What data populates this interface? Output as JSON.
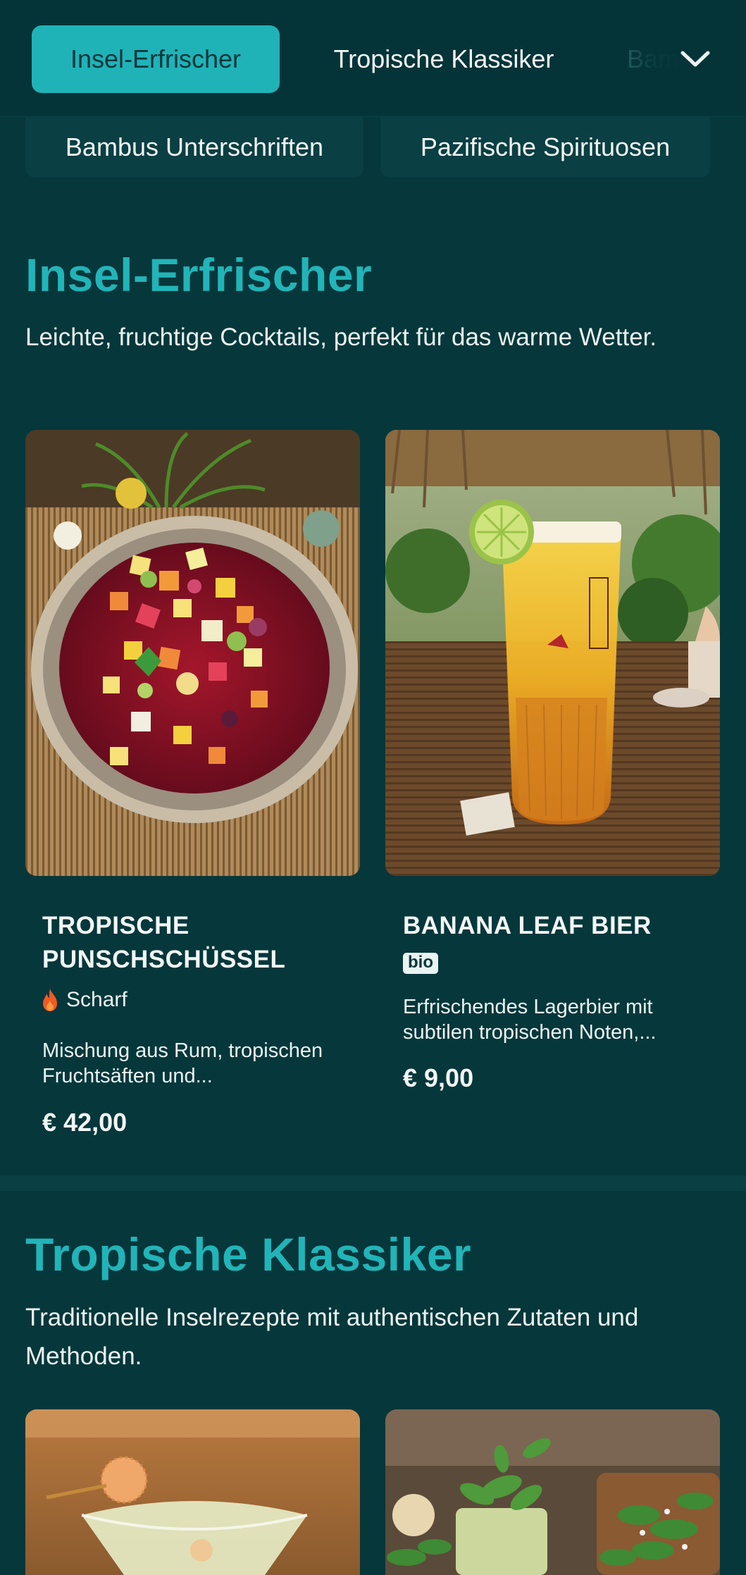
{
  "nav": {
    "tabs": [
      {
        "label": "Insel-Erfrischer",
        "active": true
      },
      {
        "label": "Tropische Klassiker",
        "active": false
      },
      {
        "label": "Bambus Unterschriften",
        "active": false
      }
    ],
    "more_icon": "chevron-down-icon",
    "pills": [
      {
        "label": "Bambus Unterschriften"
      },
      {
        "label": "Pazifische Spirituosen"
      }
    ]
  },
  "sections": [
    {
      "title": "Insel-Erfrischer",
      "description": "Leichte, fruchtige Cocktails, perfekt für das warme Wetter.",
      "items": [
        {
          "name": "TROPISCHE PUNSCHSCHÜSSEL",
          "tag": "Scharf",
          "tag_icon": "flame-icon",
          "description": "Mischung aus Rum, tropischen Fruchtsäften und...",
          "price": "€ 42,00"
        },
        {
          "name": "BANANA LEAF BIER",
          "badge": "bio",
          "description": "Erfrischendes Lagerbier mit subtilen tropischen Noten,...",
          "price": "€ 9,00"
        }
      ]
    },
    {
      "title": "Tropische Klassiker",
      "description": "Traditionelle Inselrezepte mit authentischen Zutaten und Methoden."
    }
  ],
  "colors": {
    "background": "#06373b",
    "accent": "#1fb3b8",
    "title_accent": "#21b4b8",
    "text": "#f2f7f6",
    "flame": "#f05a23"
  }
}
